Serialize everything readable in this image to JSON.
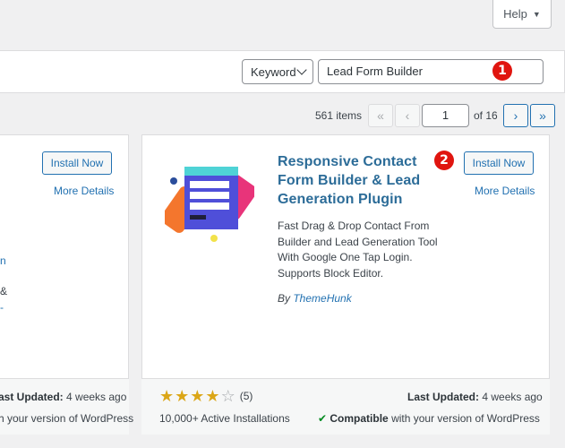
{
  "help_tab": {
    "label": "Help"
  },
  "filter": {
    "type_select": "Keyword",
    "search_value": "Lead Form Builder",
    "marker_1": "1",
    "marker_2": "2"
  },
  "pagination": {
    "items_count": "561 items",
    "first": "«",
    "prev": "‹",
    "current_page": "1",
    "of_total": "of 16",
    "next": "›",
    "last": "»"
  },
  "left_card": {
    "install_label": "Install Now",
    "more_details": "More Details",
    "fragment_1": "n",
    "fragment_2": "&",
    "fragment_3": "-",
    "last_updated_label": "ast Updated:",
    "last_updated_value": " 4 weeks ago",
    "compat_text": "h your version of WordPress"
  },
  "main_card": {
    "title": "Responsive Contact Form Builder & Lead Generation Plugin",
    "install_label": "Install Now",
    "more_details": "More Details",
    "description": "Fast Drag & Drop Contact From Builder and Lead Generation Tool With Google One Tap Login. Supports Block Editor.",
    "author_prefix": "By ",
    "author": "ThemeHunk",
    "rating_count": "(5)",
    "rating_stars": 4,
    "installs": "10,000+ Active Installations",
    "last_updated_label": "Last Updated:",
    "last_updated_value": " 4 weeks ago",
    "compat_bold": "Compatible",
    "compat_rest": " with your version of WordPress"
  },
  "colors": {
    "link": "#2271b1",
    "title": "#2c6c98",
    "marker": "#e0150f",
    "star": "#dba617"
  }
}
